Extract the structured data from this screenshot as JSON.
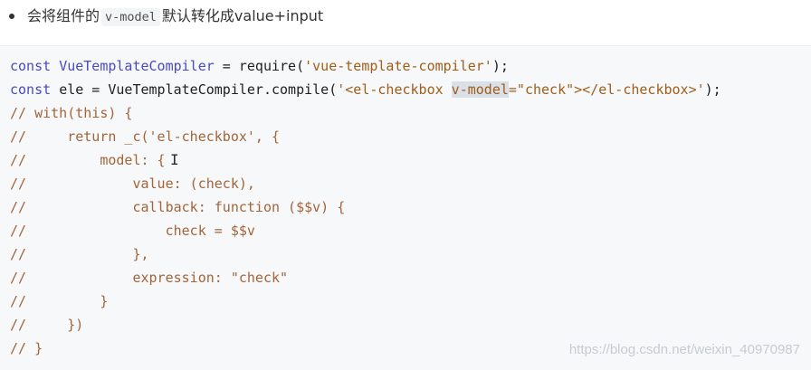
{
  "bullet": {
    "text_before": "会将组件的",
    "code": "v-model",
    "text_after": "默认转化成value+input"
  },
  "code": {
    "lines": [
      [
        {
          "t": "kw",
          "v": "const "
        },
        {
          "t": "kw",
          "v": "VueTemplateCompiler"
        },
        {
          "t": "plain",
          "v": " = require("
        },
        {
          "t": "str",
          "v": "'vue-template-compiler'"
        },
        {
          "t": "plain",
          "v": ");"
        }
      ],
      [
        {
          "t": "kw",
          "v": "const "
        },
        {
          "t": "plain",
          "v": "ele = VueTemplateCompiler.compile("
        },
        {
          "t": "str",
          "v": "'<el-checkbox "
        },
        {
          "t": "hl",
          "v": "v-model"
        },
        {
          "t": "str",
          "v": "=\"check\"></el-checkbox>'"
        },
        {
          "t": "plain",
          "v": ");"
        }
      ],
      [
        {
          "t": "comment",
          "v": "// with(this) {"
        }
      ],
      [
        {
          "t": "comment",
          "v": "//     return _c('el-checkbox', {"
        }
      ],
      [
        {
          "t": "comment",
          "v": "//         model: {"
        }
      ],
      [
        {
          "t": "comment",
          "v": "//             value: (check),"
        }
      ],
      [
        {
          "t": "comment",
          "v": "//             callback: function ($$v) {"
        }
      ],
      [
        {
          "t": "comment",
          "v": "//                 check = $$v"
        }
      ],
      [
        {
          "t": "comment",
          "v": "//             },"
        }
      ],
      [
        {
          "t": "comment",
          "v": "//             expression: \"check\""
        }
      ],
      [
        {
          "t": "comment",
          "v": "//         }"
        }
      ],
      [
        {
          "t": "comment",
          "v": "//     })"
        }
      ],
      [
        {
          "t": "comment",
          "v": "// }"
        }
      ]
    ]
  },
  "cursor_glyph": "I",
  "watermark": "https://blog.csdn.net/weixin_40970987",
  "colors": {
    "keyword": "#4a4ac0",
    "string": "#a15c18",
    "comment": "#a3643a",
    "highlight_bg": "#d9e0e8",
    "code_bg": "#f6f8fa"
  }
}
